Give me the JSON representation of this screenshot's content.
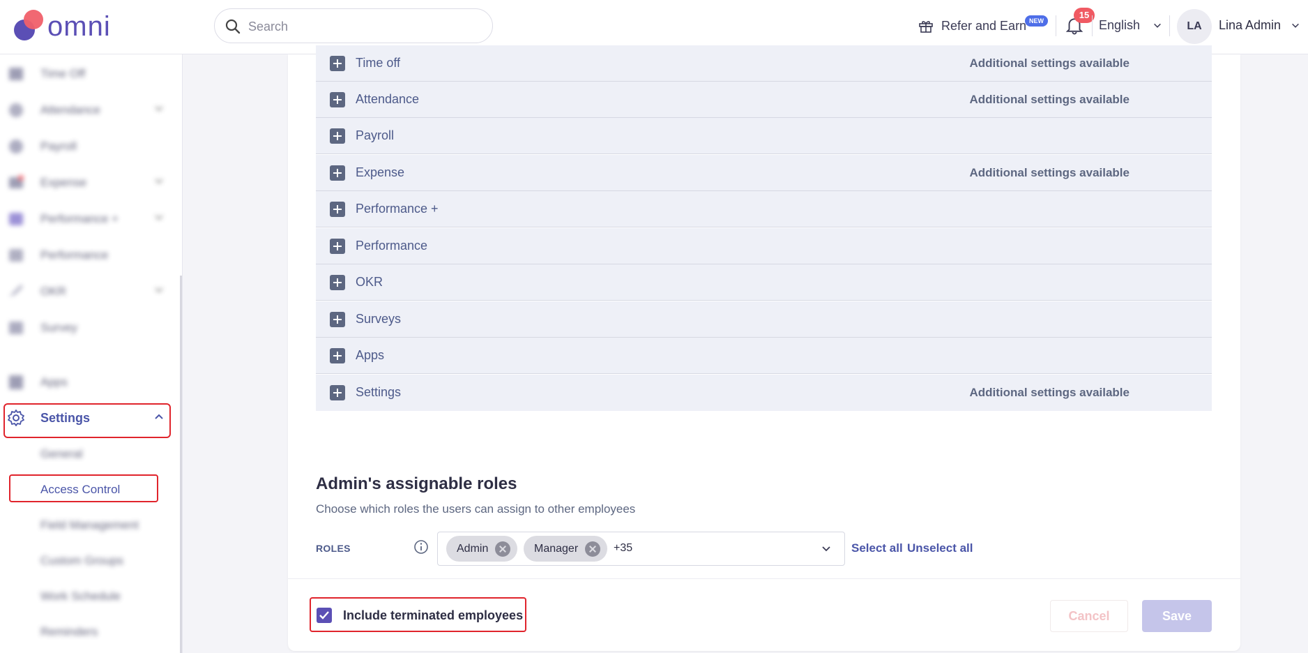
{
  "brand": {
    "name": "omni",
    "primary_color": "#5b4fb5",
    "accent_color": "#f0606a"
  },
  "header": {
    "search_placeholder": "Search",
    "refer_label": "Refer and Earn",
    "new_badge": "NEW",
    "notification_count": "15",
    "language": "English",
    "user_initials": "LA",
    "user_name": "Lina Admin"
  },
  "sidebar": {
    "items": [
      {
        "label": "Time Off",
        "icon": "time-off-icon"
      },
      {
        "label": "Attendance",
        "icon": "attendance-icon"
      },
      {
        "label": "Payroll",
        "icon": "payroll-icon"
      },
      {
        "label": "Expense",
        "icon": "expense-icon"
      },
      {
        "label": "Performance +",
        "icon": "performance-plus-icon"
      },
      {
        "label": "Performance",
        "icon": "performance-icon"
      },
      {
        "label": "OKR",
        "icon": "okr-icon"
      },
      {
        "label": "Survey",
        "icon": "survey-icon"
      },
      {
        "label": "Apps",
        "icon": "apps-icon"
      }
    ],
    "settings_label": "Settings",
    "sub_items": [
      "General",
      "Access Control",
      "Field Management",
      "Custom Groups",
      "Work Schedule",
      "Reminders"
    ]
  },
  "permissions": {
    "rows": [
      {
        "name": "Time off",
        "extra": "Additional settings available"
      },
      {
        "name": "Attendance",
        "extra": "Additional settings available"
      },
      {
        "name": "Payroll",
        "extra": ""
      },
      {
        "name": "Expense",
        "extra": "Additional settings available"
      },
      {
        "name": "Performance +",
        "extra": ""
      },
      {
        "name": "Performance",
        "extra": ""
      },
      {
        "name": "OKR",
        "extra": ""
      },
      {
        "name": "Surveys",
        "extra": ""
      },
      {
        "name": "Apps",
        "extra": ""
      },
      {
        "name": "Settings",
        "extra": "Additional settings available"
      }
    ]
  },
  "assignable_roles": {
    "title": "Admin's assignable roles",
    "description": "Choose which roles the users can assign to other employees",
    "roles_label": "ROLES",
    "chips": [
      "Admin",
      "Manager"
    ],
    "more_count": "+35",
    "select_all": "Select all",
    "unselect_all": "Unselect all"
  },
  "footer": {
    "include_terminated_label": "Include terminated employees",
    "include_terminated_checked": true,
    "cancel_label": "Cancel",
    "save_label": "Save"
  }
}
